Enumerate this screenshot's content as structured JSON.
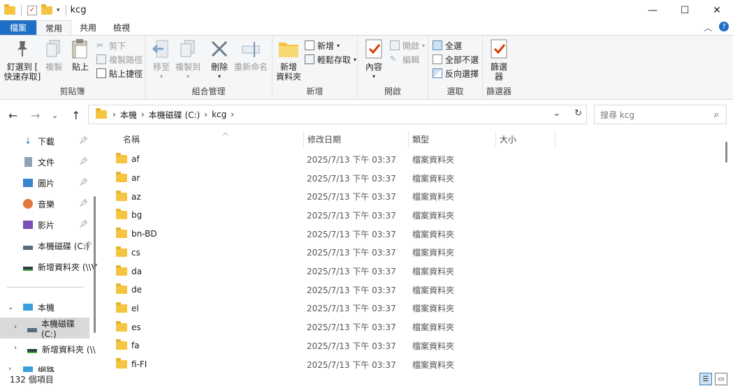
{
  "window": {
    "title": "kcg",
    "controls": {
      "minimize": "—",
      "maximize": "☐",
      "close": "✕"
    }
  },
  "ribbon_tabs": [
    {
      "label": "檔案"
    },
    {
      "label": "常用"
    },
    {
      "label": "共用"
    },
    {
      "label": "檢視"
    }
  ],
  "ribbon": {
    "clipboard": {
      "label": "剪貼簿",
      "pin": "釘選到 [\n快速存取]",
      "copy": "複製",
      "paste": "貼上",
      "cut": "剪下",
      "copy_path": "複製路徑",
      "paste_shortcut": "貼上捷徑"
    },
    "organize": {
      "label": "組合管理",
      "move_to": "移至",
      "copy_to": "複製到",
      "delete": "刪除",
      "rename": "重新命名"
    },
    "new": {
      "label": "新增",
      "new_folder": "新增\n資料夾",
      "new_item": "新增",
      "easy_access": "輕鬆存取"
    },
    "open": {
      "label": "開啟",
      "properties": "內容",
      "open": "開啟",
      "edit": "編輯"
    },
    "select": {
      "label": "選取",
      "select_all": "全選",
      "select_none": "全部不選",
      "invert": "反向選擇"
    },
    "filter": {
      "label": "篩選器",
      "filter": "篩選\n器"
    }
  },
  "address": {
    "crumbs": [
      "本機",
      "本機磁碟 (C:)",
      "kcg"
    ],
    "search_placeholder": "搜尋 kcg"
  },
  "sidebar": {
    "quick": [
      {
        "label": "下載"
      },
      {
        "label": "文件"
      },
      {
        "label": "圖片"
      },
      {
        "label": "音樂"
      },
      {
        "label": "影片"
      },
      {
        "label": "本機磁碟 (C:)"
      },
      {
        "label": "新增資料夾 (\\\\V"
      }
    ],
    "pc": {
      "label": "本機"
    },
    "drives": [
      {
        "label": "本機磁碟 (C:)"
      },
      {
        "label": "新增資料夾 (\\\\"
      }
    ],
    "network": {
      "label": "網路"
    }
  },
  "columns": {
    "name": "名稱",
    "date": "修改日期",
    "type": "類型",
    "size": "大小"
  },
  "files": [
    {
      "name": "af",
      "date": "2025/7/13 下午 03:37",
      "type": "檔案資料夾"
    },
    {
      "name": "ar",
      "date": "2025/7/13 下午 03:37",
      "type": "檔案資料夾"
    },
    {
      "name": "az",
      "date": "2025/7/13 下午 03:37",
      "type": "檔案資料夾"
    },
    {
      "name": "bg",
      "date": "2025/7/13 下午 03:37",
      "type": "檔案資料夾"
    },
    {
      "name": "bn-BD",
      "date": "2025/7/13 下午 03:37",
      "type": "檔案資料夾"
    },
    {
      "name": "cs",
      "date": "2025/7/13 下午 03:37",
      "type": "檔案資料夾"
    },
    {
      "name": "da",
      "date": "2025/7/13 下午 03:37",
      "type": "檔案資料夾"
    },
    {
      "name": "de",
      "date": "2025/7/13 下午 03:37",
      "type": "檔案資料夾"
    },
    {
      "name": "el",
      "date": "2025/7/13 下午 03:37",
      "type": "檔案資料夾"
    },
    {
      "name": "es",
      "date": "2025/7/13 下午 03:37",
      "type": "檔案資料夾"
    },
    {
      "name": "fa",
      "date": "2025/7/13 下午 03:37",
      "type": "檔案資料夾"
    },
    {
      "name": "fi-FI",
      "date": "2025/7/13 下午 03:37",
      "type": "檔案資料夾"
    }
  ],
  "status": {
    "count": "132 個項目"
  },
  "colors": {
    "accent": "#1e6fc6",
    "folder": "#f5c542",
    "selected": "#d9d9d9"
  }
}
